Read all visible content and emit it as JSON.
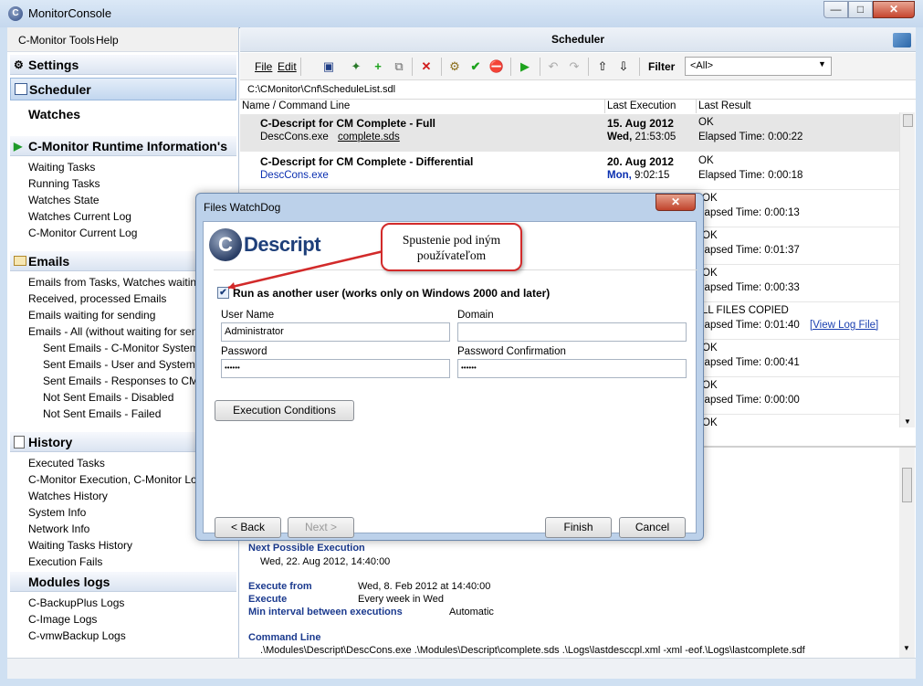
{
  "window": {
    "title": "MonitorConsole",
    "icon": "C"
  },
  "menubar": {
    "tools": "C-Monitor Tools",
    "help": "Help"
  },
  "sidebar": {
    "settings": "Settings",
    "scheduler": "Scheduler",
    "watches": "Watches",
    "runtime": {
      "title": "C-Monitor Runtime Information's",
      "items": [
        "Waiting Tasks",
        "Running Tasks",
        "Watches State",
        "Watches Current Log",
        "C-Monitor Current Log"
      ]
    },
    "emails": {
      "title": "Emails",
      "items": [
        "Emails from Tasks, Watches waiting for",
        "Received, processed Emails",
        "Emails waiting for sending",
        "Emails - All (without waiting for sending"
      ],
      "subitems": [
        "Sent Emails - C-Monitor System Mes",
        "Sent Emails - User and System task",
        "Sent Emails - Responses to CM que",
        "Not Sent Emails - Disabled",
        "Not Sent Emails - Failed"
      ]
    },
    "history": {
      "title": "History",
      "items": [
        "Executed Tasks",
        "C-Monitor Execution, C-Monitor Log His",
        "Watches History",
        "System Info",
        "Network Info",
        "Waiting Tasks History",
        "Execution Fails"
      ]
    },
    "modules": {
      "title": "Modules logs",
      "items": [
        "C-BackupPlus Logs",
        "C-Image Logs",
        "C-vmwBackup Logs"
      ]
    }
  },
  "scheduler": {
    "title": "Scheduler",
    "toolbar": {
      "file": "File",
      "edit": "Edit",
      "filter_label": "Filter",
      "filter_value": "<All>"
    },
    "path": "C:\\CMonitor\\Cnf\\ScheduleList.sdl",
    "columns": [
      "Name / Command Line",
      "Last Execution",
      "Last Result"
    ],
    "rows": [
      {
        "name": "C-Descript for CM Complete - Full",
        "cmd": "DescCons.exe",
        "link": "complete.sds",
        "date": "15. Aug 2012",
        "day": "Wed,",
        "time": "21:53:05",
        "result": "OK",
        "elapsed": "Elapsed Time: 0:00:22"
      },
      {
        "name": "C-Descript for CM Complete - Differential",
        "cmd": "DescCons.exe",
        "link": "",
        "date": "20. Aug 2012",
        "day": "Mon,",
        "time": "9:02:15",
        "result": "OK",
        "elapsed": "Elapsed Time: 0:00:18"
      }
    ],
    "hidden_results": [
      {
        "r1": "OK",
        "r2": "lapsed Time: 0:00:13"
      },
      {
        "r1": "OK",
        "r2": "lapsed Time: 0:01:37"
      },
      {
        "r1": "OK",
        "r2": "lapsed Time: 0:00:33"
      },
      {
        "r1": "LL FILES COPIED",
        "r2": "lapsed Time: 0:01:40",
        "link": "[View Log File]"
      },
      {
        "r1": "OK",
        "r2": "lapsed Time: 0:00:41"
      },
      {
        "r1": "OK",
        "r2": "lapsed Time: 0:00:00"
      },
      {
        "r1": "OK",
        "r2": ""
      }
    ],
    "details": {
      "next_label": "Next Possible Execution",
      "next_value": "Wed, 22. Aug 2012, 14:40:00",
      "exec_from_label": "Execute from",
      "exec_from_value": "Wed, 8. Feb 2012 at 14:40:00",
      "execute_label": "Execute",
      "execute_value": "Every week in Wed",
      "min_label": "Min interval between executions",
      "min_value": "Automatic",
      "cmd_label": "Command Line",
      "cmd_value": ".\\Modules\\Descript\\DescCons.exe .\\Modules\\Descript\\complete.sds .\\Logs\\lastdesccpl.xml -xml -eof.\\Logs\\lastcomplete.sdf"
    }
  },
  "dialog": {
    "title": "Files WatchDog",
    "logo_c": "C",
    "logo_text": "Descript",
    "checkbox_label": "Run as another user  (works only on Windows 2000 and later)",
    "checkbox_checked": true,
    "username_label": "User Name",
    "username_value": "Administrator",
    "domain_label": "Domain",
    "domain_value": "",
    "password_label": "Password",
    "password_value": "••••••",
    "password_confirm_label": "Password Confirmation",
    "password_confirm_value": "••••••",
    "exec_conditions": "Execution Conditions",
    "back": "< Back",
    "next": "Next >",
    "finish": "Finish",
    "cancel": "Cancel"
  },
  "callout": {
    "line1": "Spustenie pod iným",
    "line2": "používateľom"
  },
  "colors": {
    "accent_blue": "#1b3a8e",
    "callout_red": "#d22a2a"
  }
}
